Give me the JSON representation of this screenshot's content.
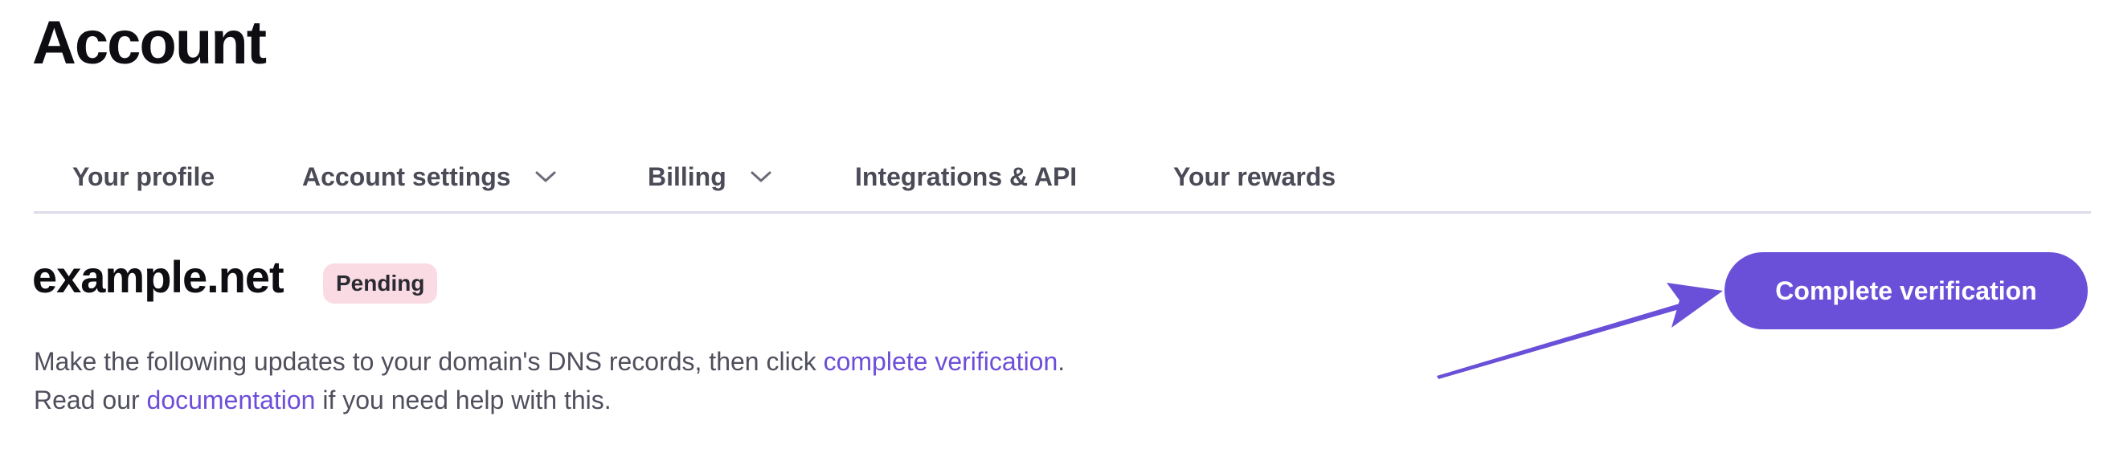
{
  "header": {
    "title": "Account"
  },
  "tabs": [
    {
      "label": "Your profile",
      "has_dropdown": false,
      "icon": ""
    },
    {
      "label": "Account settings",
      "has_dropdown": true,
      "icon": "chevron-down-icon"
    },
    {
      "label": "Billing",
      "has_dropdown": true,
      "icon": "chevron-down-icon"
    },
    {
      "label": "Integrations & API",
      "has_dropdown": false,
      "icon": ""
    },
    {
      "label": "Your rewards",
      "has_dropdown": false,
      "icon": ""
    }
  ],
  "domain": {
    "name": "example.net",
    "status": "Pending",
    "status_color": "#fbdbe3"
  },
  "description": {
    "line1_before": "Make the following updates to your domain's DNS records, then click ",
    "line1_link": "complete verification",
    "line1_after": ".",
    "line2_before": "Read our ",
    "line2_link": "documentation",
    "line2_after": " if you need help with this."
  },
  "actions": {
    "complete_label": "Complete verification"
  },
  "annotation": {
    "icon": "arrow-pointer-icon",
    "color": "#6a4fd8"
  },
  "colors": {
    "accent": "#6a4fd8",
    "link": "#6d4ed8",
    "divider": "#dcdcea"
  }
}
